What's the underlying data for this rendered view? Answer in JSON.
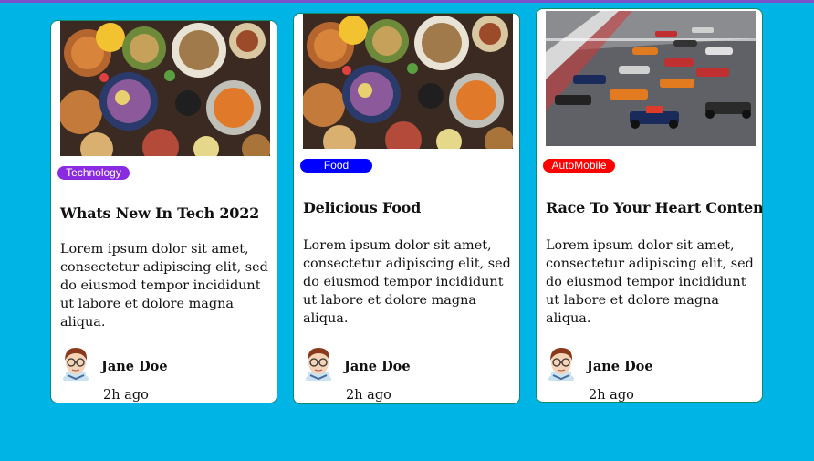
{
  "colors": {
    "background": "#00b4e6",
    "card_border": "#0f8a6a",
    "tag_technology": "#8a2be2",
    "tag_food": "#0000ff",
    "tag_automobile": "#ff0000"
  },
  "cards": [
    {
      "image": "food-platter-image",
      "tag": "Technology",
      "title": "Whats New In Tech 2022",
      "body": "Lorem ipsum dolor sit amet, consectetur adipiscing elit, sed do eiusmod tempor incididunt ut labore et dolore magna aliqua.",
      "author": "Jane Doe",
      "time": "2h ago"
    },
    {
      "image": "food-platter-image",
      "tag": "Food",
      "title": "Delicious Food",
      "body": "Lorem ipsum dolor sit amet, consectetur adipiscing elit, sed do eiusmod tempor incididunt ut labore et dolore magna aliqua.",
      "author": "Jane Doe",
      "time": "2h ago"
    },
    {
      "image": "race-cars-image",
      "tag": "AutoMobile",
      "title": "Race To Your Heart Content",
      "body": "Lorem ipsum dolor sit amet, consectetur adipiscing elit, sed do eiusmod tempor incididunt ut labore et dolore magna aliqua.",
      "author": "Jane Doe",
      "time": "2h ago"
    }
  ]
}
